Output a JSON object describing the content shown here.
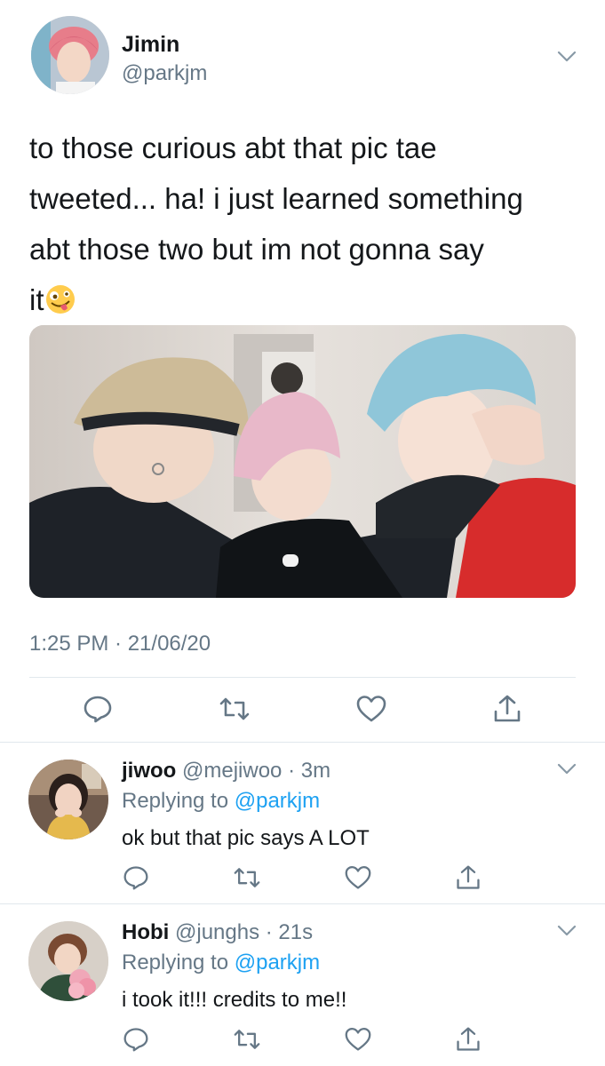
{
  "main_tweet": {
    "author_name": "Jimin",
    "author_handle": "@parkjm",
    "text": "to those curious abt that pic tae\ntweeted... ha! i just learned something\nabt those two but im not gonna say\nit",
    "emoji": "zany-face-emoji",
    "timestamp": "1:25 PM · 21/06/20",
    "media": "photo of three people with blonde, pink and light blue hair",
    "actions": [
      "reply-icon",
      "retweet-icon",
      "like-icon",
      "share-icon"
    ]
  },
  "replies": [
    {
      "author_name": "jiwoo",
      "author_handle": "@mejiwoo",
      "time_ago": "3m",
      "replying_prefix": "Replying to",
      "replying_to": "@parkjm",
      "text": "ok but that pic says A LOT"
    },
    {
      "author_name": "Hobi",
      "author_handle": "@junghs",
      "time_ago": "21s",
      "replying_prefix": "Replying to",
      "replying_to": "@parkjm",
      "text": "i took it!!! credits to me!!"
    }
  ],
  "colors": {
    "text": "#14171a",
    "secondary": "#657786",
    "link": "#1da1f2",
    "divider": "#e1e8ed"
  }
}
